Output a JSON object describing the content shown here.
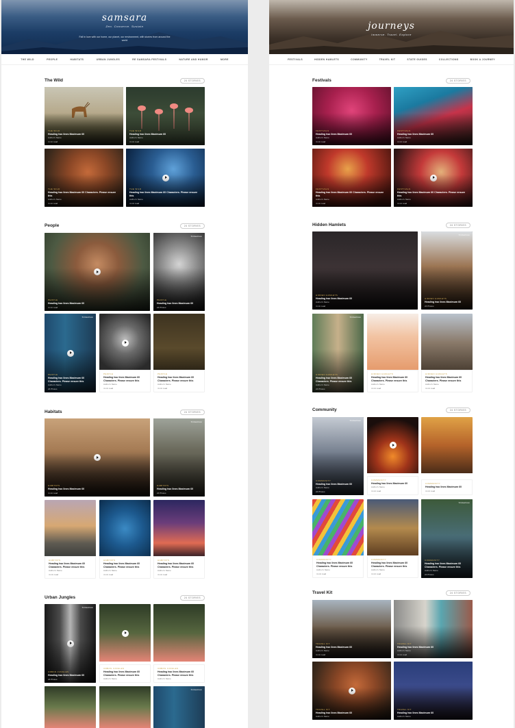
{
  "left": {
    "site_title": "samsara",
    "tagline": "Zen. Conserve. Sustain",
    "description": "Fall in love with our home, our planet, our environment, with stories from around the world",
    "nav": [
      "The Wild",
      "People",
      "Habitats",
      "Urban Jungles",
      "Re Samsara Festivals",
      "Nature and Humor",
      "More"
    ],
    "sections": [
      {
        "title": "The Wild",
        "badge": "24 STORIES"
      },
      {
        "title": "People",
        "badge": "24 STORIES"
      },
      {
        "title": "Habitats",
        "badge": "24 STORIES"
      },
      {
        "title": "Urban Jungles",
        "badge": "24 STORIES"
      }
    ]
  },
  "right": {
    "site_title": "journeys",
    "tagline": "Immerse. Travel. Explore",
    "nav": [
      "Festivals",
      "Hidden Hamlets",
      "Community",
      "Travel Kit",
      "State Guides",
      "Collections",
      "Book a Journey"
    ],
    "sections": [
      {
        "title": "Festivals",
        "badge": "24 STORIES"
      },
      {
        "title": "Hidden Hamlets",
        "badge": "24 STORIES"
      },
      {
        "title": "Community",
        "badge": "24 STORIES"
      },
      {
        "title": "Travel Kit",
        "badge": "24 STORIES"
      }
    ]
  },
  "card": {
    "heading": "Heading two lines Maximum 60 Characters. Please ensure this",
    "heading_short": "Heading two lines Maximum 60",
    "author": "Author's Name",
    "read": "4 min read",
    "photos": "24 Photos",
    "views": "30 Views",
    "slideshow": "Slideshow",
    "cat_wild": "The Wild",
    "cat_people": "People",
    "cat_habitats": "Habitats",
    "cat_urban": "Urban Jungles",
    "cat_festivals": "Festivals",
    "cat_hamlets": "Hidden Hamlets",
    "cat_community": "Community",
    "cat_travel": "Travel Kit"
  }
}
